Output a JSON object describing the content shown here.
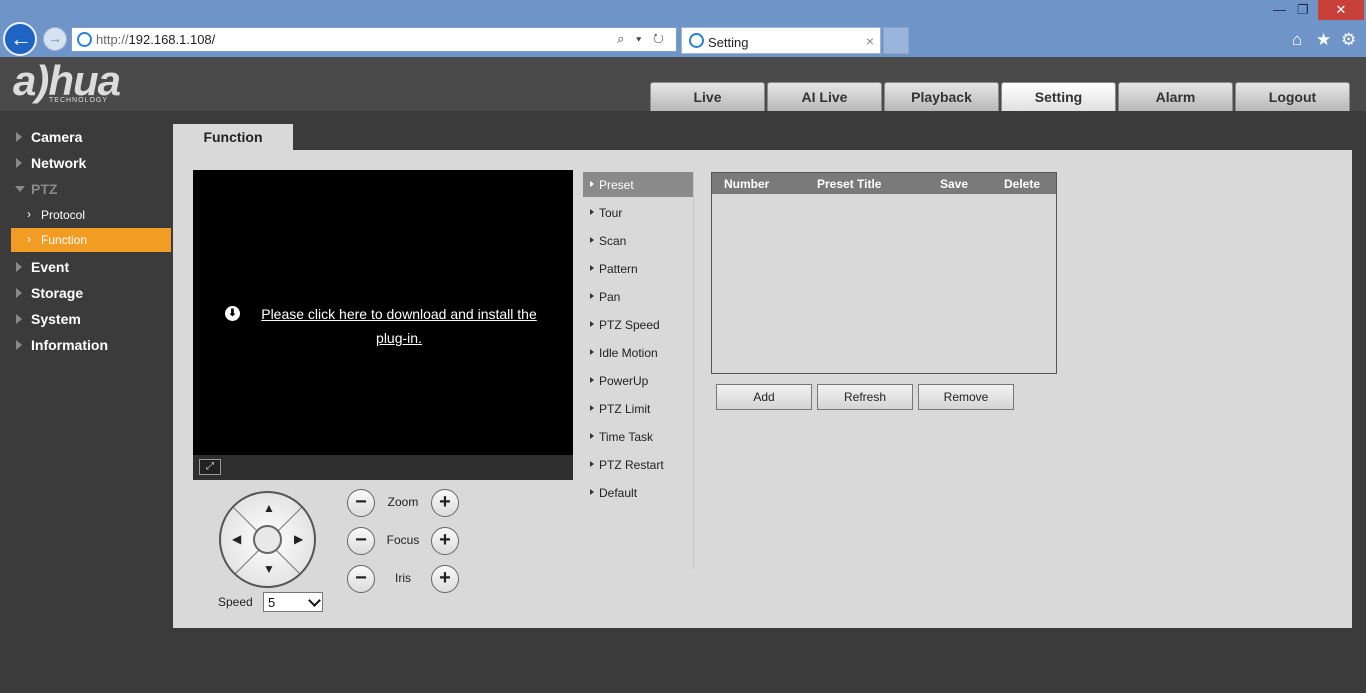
{
  "browser": {
    "url_host": "http://",
    "url_path": "192.168.1.108/",
    "url_controls": "⌕ ▾ ↻",
    "tab_title": "Setting",
    "tab_close": "×",
    "win_min": "—",
    "win_restore": "❐",
    "win_close": "✕",
    "home": "⌂",
    "fav": "★",
    "settings": "⚙",
    "back_icon": "←",
    "fwd_icon": "→"
  },
  "logo": {
    "word": "a)hua",
    "sub": "TECHNOLOGY"
  },
  "main_tabs": [
    "Live",
    "AI Live",
    "Playback",
    "Setting",
    "Alarm",
    "Logout"
  ],
  "sidebar": {
    "items": [
      "Camera",
      "Network",
      "PTZ",
      "Event",
      "Storage",
      "System",
      "Information"
    ],
    "ptz_sub": [
      "Protocol",
      "Function"
    ],
    "chev": "›"
  },
  "content": {
    "tab_title": "Function",
    "plugin_text": "Please click here to download and install the plug-in.",
    "download_icon": "⬇",
    "fullscreen_icon": "⤢"
  },
  "ptz": {
    "arrows": {
      "up": "▲",
      "down": "▼",
      "left": "◀",
      "right": "▶"
    },
    "speed_label": "Speed",
    "speed_value": "5",
    "minus": "−",
    "plus": "+",
    "zoom": "Zoom",
    "focus": "Focus",
    "iris": "Iris"
  },
  "function_menu": [
    "Preset",
    "Tour",
    "Scan",
    "Pattern",
    "Pan",
    "PTZ Speed",
    "Idle Motion",
    "PowerUp",
    "PTZ Limit",
    "Time Task",
    "PTZ Restart",
    "Default"
  ],
  "preset_table": {
    "columns": [
      "Number",
      "Preset Title",
      "Save",
      "Delete"
    ]
  },
  "buttons": {
    "add": "Add",
    "refresh": "Refresh",
    "remove": "Remove"
  }
}
